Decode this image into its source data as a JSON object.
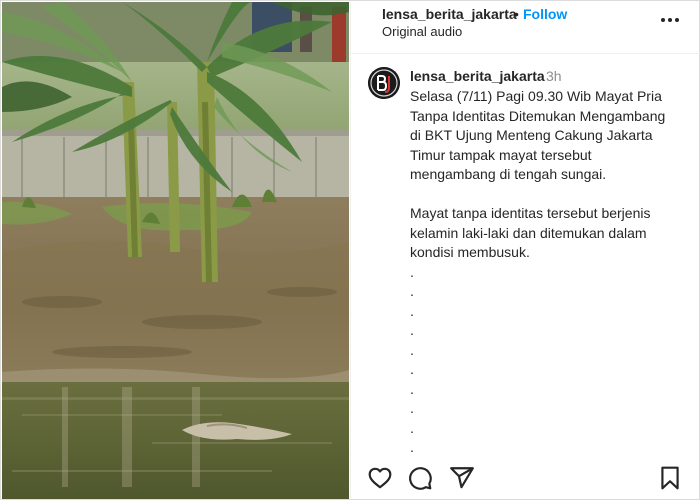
{
  "post_header": {
    "username": "lensa_berita_jakarta",
    "separator": "•",
    "follow_label": "Follow",
    "audio_label": "Original audio"
  },
  "caption": {
    "username": "lensa_berita_jakarta",
    "time_ago": "3h",
    "lines": [
      "Selasa (7/11) Pagi 09.30 Wib Mayat Pria",
      "Tanpa Identitas Ditemukan Mengambang",
      "di BKT Ujung Menteng Cakung Jakarta",
      "Timur tampak mayat tersebut",
      "mengambang di tengah sungai.",
      "",
      "Mayat tanpa identitas tersebut berjenis",
      "kelamin laki-laki dan ditemukan dalam",
      "kondisi membusuk.",
      ".",
      ".",
      ".",
      ".",
      ".",
      ".",
      ".",
      ".",
      ".",
      "."
    ]
  },
  "icons": {
    "more": "more-options-icon",
    "like": "heart-icon",
    "comment": "comment-icon",
    "share": "send-icon",
    "save": "bookmark-icon"
  },
  "colors": {
    "follow": "#0095f6",
    "text": "#262626",
    "muted": "#8e8e8e"
  }
}
